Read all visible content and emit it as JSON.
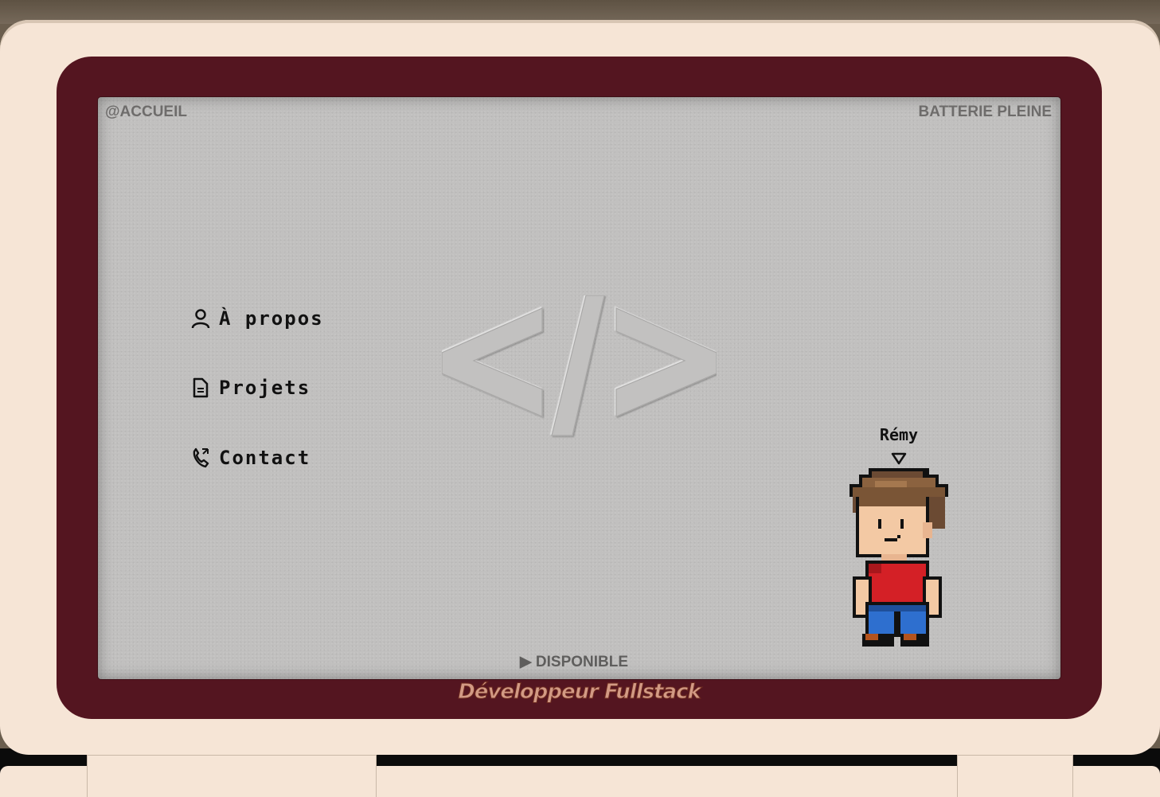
{
  "hud": {
    "left_label": "@ACCUEIL",
    "right_label": "BATTERIE PLEINE"
  },
  "menu": {
    "items": [
      {
        "label": "À propos",
        "icon": "user-icon"
      },
      {
        "label": "Projets",
        "icon": "document-icon"
      },
      {
        "label": "Contact",
        "icon": "phone-icon"
      }
    ]
  },
  "status": {
    "text": "▶ DISPONIBLE"
  },
  "character": {
    "name": "Rémy",
    "pointer_icon": "down-triangle-icon"
  },
  "footer": {
    "subtitle": "Développeur Fullstack"
  },
  "center_icon": "code-brackets-icon",
  "colors": {
    "device_shell": "#f6e5d6",
    "screen_frame": "#541520",
    "screen": "#c1c0bf",
    "subtitle_fill": "#d29a84"
  }
}
